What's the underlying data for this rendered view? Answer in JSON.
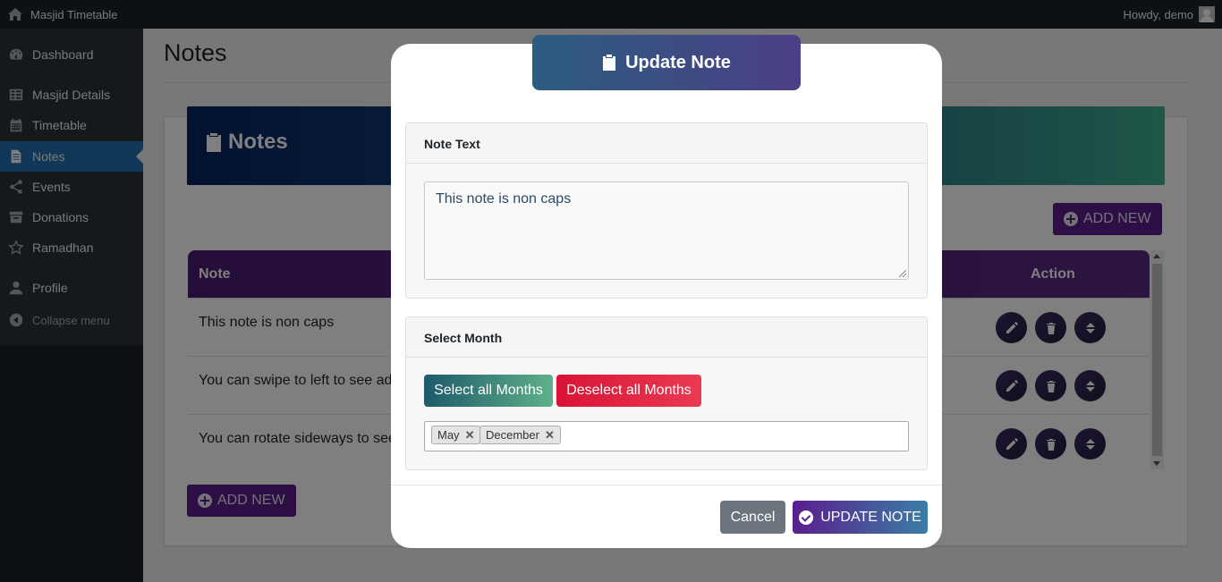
{
  "adminbar": {
    "site_name": "Masjid Timetable",
    "howdy": "Howdy, demo"
  },
  "sidebar": {
    "items": [
      {
        "label": "Dashboard",
        "icon": "dashboard-icon"
      },
      {
        "label": "Masjid Details",
        "icon": "table-icon"
      },
      {
        "label": "Timetable",
        "icon": "calendar-icon"
      },
      {
        "label": "Notes",
        "icon": "document-icon",
        "active": true
      },
      {
        "label": "Events",
        "icon": "share-icon"
      },
      {
        "label": "Donations",
        "icon": "archive-icon"
      },
      {
        "label": "Ramadhan",
        "icon": "star-icon"
      },
      {
        "label": "Profile",
        "icon": "user-icon"
      }
    ],
    "collapse_label": "Collapse menu"
  },
  "main": {
    "page_title": "Notes",
    "banner_title": "Notes",
    "add_new_label": "ADD NEW",
    "table": {
      "columns": [
        "Note",
        "Action"
      ],
      "rows": [
        {
          "note": "This note is non caps"
        },
        {
          "note": "You can swipe to left to see ad"
        },
        {
          "note": "You can rotate sideways to see"
        }
      ]
    }
  },
  "modal": {
    "title": "Update Note",
    "note_text_heading": "Note Text",
    "note_text_value": "This note is non caps",
    "select_month_heading": "Select Month",
    "select_all_label": "Select all Months",
    "deselect_all_label": "Deselect all Months",
    "selected_months": [
      "May",
      "December"
    ],
    "chip_remove": "✕",
    "cancel_label": "Cancel",
    "update_label": "UPDATE NOTE"
  },
  "colors": {
    "accent_blue": "#2271b1",
    "purple": "#5b1f8d",
    "danger": "#d81436"
  }
}
